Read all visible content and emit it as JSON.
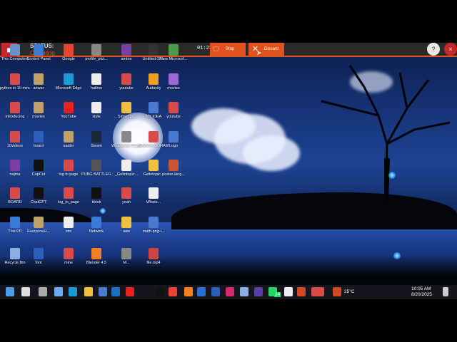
{
  "recorder": {
    "status_label": "STATUS:",
    "status_value": "Capturing",
    "time": "01:21",
    "stop_label": "Stop",
    "discard_label": "Discard",
    "help_label": "?",
    "close_label": "×"
  },
  "desktop_icons": [
    {
      "label": "This Computers",
      "color": "#6a90c8"
    },
    {
      "label": "Control Panel",
      "color": "#3a7bd5"
    },
    {
      "label": "Google",
      "color": "#e84335"
    },
    {
      "label": "profile_pict...",
      "color": "#888888"
    },
    {
      "label": "amiira",
      "color": "#7a3fa0"
    },
    {
      "label": "Untitled-2P...",
      "color": "#333333"
    },
    {
      "label": "New Microsof...",
      "color": "#4a9c4a"
    },
    {
      "label": "python in 10 minutes",
      "color": "#d94a4a"
    },
    {
      "label": "anwar",
      "color": "#bfa16a"
    },
    {
      "label": "Microsoft Edge",
      "color": "#1a9bd6"
    },
    {
      "label": "halimo",
      "color": "#eeeeee"
    },
    {
      "label": "youtube",
      "color": "#d94a4a"
    },
    {
      "label": "Audacity",
      "color": "#f0a020"
    },
    {
      "label": "movies",
      "color": "#9c6ad0"
    },
    {
      "label": "introducing",
      "color": "#d94a4a"
    },
    {
      "label": "movies",
      "color": "#bfa16a"
    },
    {
      "label": "YouTube",
      "color": "#e82020"
    },
    {
      "label": "style",
      "color": "#eeeeee"
    },
    {
      "label": "_ Simlengi_...",
      "color": "#f0c040"
    },
    {
      "label": "MY IDEA",
      "color": "#4a7ad0"
    },
    {
      "label": "youtube",
      "color": "#d94a4a"
    },
    {
      "label": "10videos",
      "color": "#d94a4a"
    },
    {
      "label": "board",
      "color": "#2b5fb8"
    },
    {
      "label": "saabir",
      "color": "#bfa16a"
    },
    {
      "label": "Steam",
      "color": "#1b2838"
    },
    {
      "label": "WhatsApp Image 2025...",
      "color": "#888888"
    },
    {
      "label": "SAWDA MOHAMED...",
      "color": "#d94a4a"
    },
    {
      "label": "Logo",
      "color": "#4a7ad0"
    },
    {
      "label": "najma",
      "color": "#7a3fa0"
    },
    {
      "label": "CapCut",
      "color": "#111111"
    },
    {
      "label": "log in page",
      "color": "#d94a4a"
    },
    {
      "label": "PUBG BATTLEGRO...",
      "color": "#555555"
    },
    {
      "label": "_Gelintopic...",
      "color": "#eeeeee"
    },
    {
      "label": "Gelintopic...",
      "color": "#f0c040"
    },
    {
      "label": "poster-king...",
      "color": "#cc5533"
    },
    {
      "label": "BOARD",
      "color": "#d94a4a"
    },
    {
      "label": "ChatGPT",
      "color": "#111111"
    },
    {
      "label": "log_in_page",
      "color": "#d94a4a"
    },
    {
      "label": "tiktok",
      "color": "#111111"
    },
    {
      "label": "yeah",
      "color": "#d94a4a"
    },
    {
      "label": "Whats...",
      "color": "#eeeeee"
    },
    {
      "label": "This PC",
      "color": "#3a7bd5"
    },
    {
      "label": "EveryoneH...",
      "color": "#bfa16a"
    },
    {
      "label": "sss",
      "color": "#eeeeee"
    },
    {
      "label": "Network",
      "color": "#3a7bd5"
    },
    {
      "label": "aaw",
      "color": "#f0c040"
    },
    {
      "label": "math-png-i...",
      "color": "#4a7ad0"
    },
    {
      "label": "Recycle Bin",
      "color": "#8ab0e0"
    },
    {
      "label": "font",
      "color": "#2b5fb8"
    },
    {
      "label": "mine",
      "color": "#d94a4a"
    },
    {
      "label": "Blender 4.5",
      "color": "#f08020"
    },
    {
      "label": "M...",
      "color": "#888888"
    },
    {
      "label": "file.mp4",
      "color": "#cc4444"
    }
  ],
  "taskbar": {
    "weather": "25°C",
    "time": "10:05 AM",
    "date": "8/20/2025",
    "badge": "24",
    "apps": [
      {
        "name": "windows-start-icon",
        "color": "#4a9ee8"
      },
      {
        "name": "search-icon",
        "color": "#dddddd"
      },
      {
        "name": "task-view-icon",
        "color": "#aaaaaa"
      },
      {
        "name": "copilot-icon",
        "color": "#6fa8f0"
      },
      {
        "name": "edge-icon",
        "color": "#1a9bd6"
      },
      {
        "name": "file-explorer-icon",
        "color": "#f0c040"
      },
      {
        "name": "store-icon",
        "color": "#4a7ad0"
      },
      {
        "name": "outlook-icon",
        "color": "#1a6fc4"
      },
      {
        "name": "youtube-icon",
        "color": "#e82020"
      },
      {
        "name": "tiktok-icon",
        "color": "#111111"
      },
      {
        "name": "chrome-icon",
        "color": "#e84335"
      },
      {
        "name": "app-icon",
        "color": "#f08020"
      },
      {
        "name": "photoshop-icon",
        "color": "#2a6fd0"
      },
      {
        "name": "word-icon",
        "color": "#2b5fb8"
      },
      {
        "name": "indesign-icon",
        "color": "#d42a6a"
      },
      {
        "name": "app2-icon",
        "color": "#8ab0e0"
      },
      {
        "name": "after-effects-icon",
        "color": "#5a3fa0"
      },
      {
        "name": "capcut-icon",
        "color": "#eeeeee"
      },
      {
        "name": "whatsapp-icon",
        "color": "#25d366"
      },
      {
        "name": "powerpoint-icon",
        "color": "#d24726"
      },
      {
        "name": "app3-icon",
        "color": "#d94a4a"
      },
      {
        "name": "recorder-icon",
        "color": "#d94a4a"
      }
    ]
  }
}
